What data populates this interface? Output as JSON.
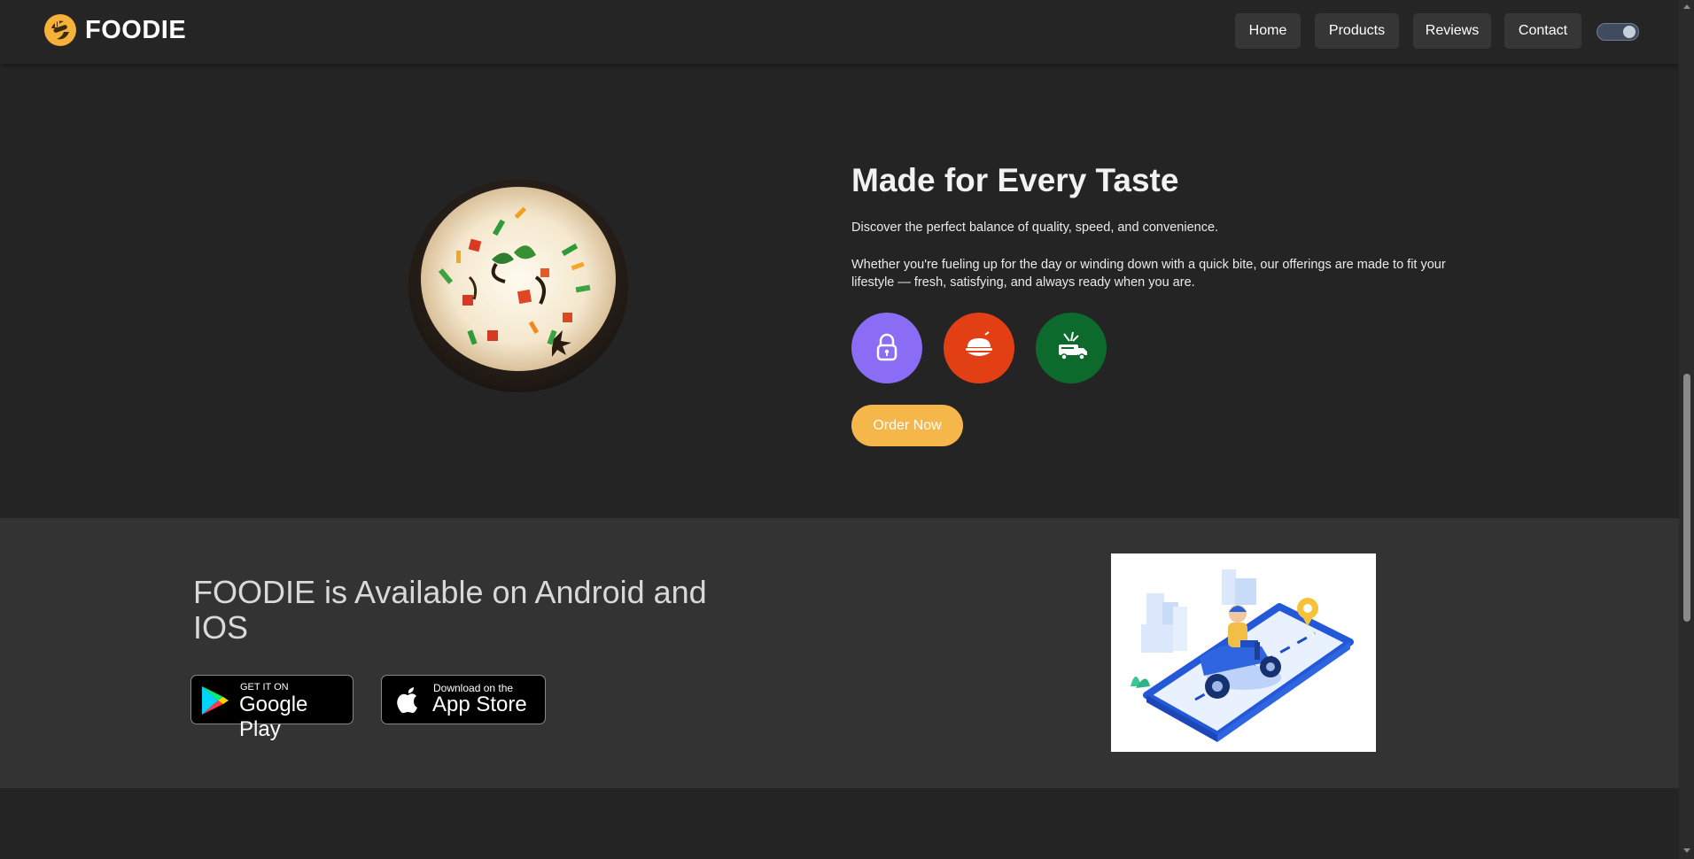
{
  "brand": {
    "name": "FOODIE",
    "logo_icon": "fork-spoon-logo-icon",
    "accent_color": "#f5b64a"
  },
  "nav": {
    "links": [
      "Home",
      "Products",
      "Reviews",
      "Contact"
    ],
    "theme_toggle": {
      "state": "dark"
    }
  },
  "hero": {
    "title": "Made for Every Taste",
    "paragraph1": "Discover the perfect balance of quality, speed, and convenience.",
    "paragraph2": "Whether you're fueling up for the day or winding down with a quick bite, our offerings are made to fit your lifestyle — fresh, satisfying, and always ready when you are.",
    "image": "biryani-bowl-image",
    "features": [
      {
        "icon": "lock-icon",
        "color": "#8b6cf5"
      },
      {
        "icon": "food-bowl-icon",
        "color": "#e23f14"
      },
      {
        "icon": "delivery-truck-icon",
        "color": "#0b6a2c"
      }
    ],
    "cta": "Order Now"
  },
  "app": {
    "title": "FOODIE is Available on Android and IOS",
    "google_play": {
      "small": "GET IT ON",
      "big": "Google Play"
    },
    "app_store": {
      "small": "Download on the",
      "big": "App Store"
    },
    "illustration": "scooter-delivery-illustration"
  }
}
